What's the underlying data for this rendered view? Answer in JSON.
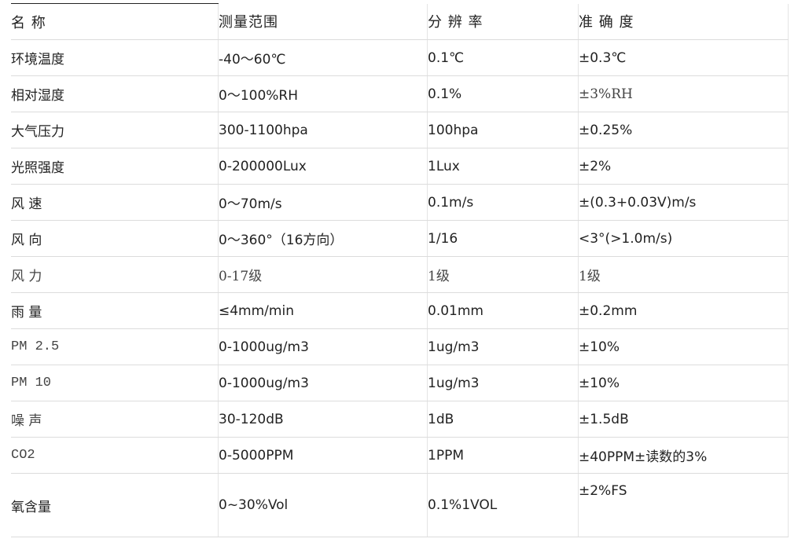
{
  "table": {
    "headers": [
      "名 称",
      "测量范围",
      "分 辨 率",
      "准 确 度"
    ],
    "rows": [
      {
        "name": "环境温度",
        "range": "-40～60℃",
        "resolution": "0.1℃",
        "accuracy": "±0.3℃"
      },
      {
        "name": "相对湿度",
        "range": "0～100%RH",
        "resolution": "0.1%",
        "accuracy": "±3%RH"
      },
      {
        "name": "大气压力",
        "range": "300-1100hpa",
        "resolution": "100hpa",
        "accuracy": "±0.25%"
      },
      {
        "name": "光照强度",
        "range": "0-200000Lux",
        "resolution": "1Lux",
        "accuracy": "±2%"
      },
      {
        "name": "风   速",
        "range": "0～70m/s",
        "resolution": "0.1m/s",
        "accuracy": "±(0.3+0.03V)m/s"
      },
      {
        "name": "风   向",
        "range": "0～360°（16方向）",
        "resolution": "1/16",
        "accuracy": "<3°(>1.0m/s)"
      },
      {
        "name": "风     力",
        "range": "0-17级",
        "resolution": "1级",
        "accuracy": "1级"
      },
      {
        "name": "雨 量",
        "range": "≤4mm/min",
        "resolution": "0.01mm",
        "accuracy": "±0.2mm"
      },
      {
        "name": "PM    2.5",
        "range": "0-1000ug/m3",
        "resolution": "1ug/m3",
        "accuracy": "±10%"
      },
      {
        "name": "PM   10",
        "range": "0-1000ug/m3",
        "resolution": "1ug/m3",
        "accuracy": "±10%"
      },
      {
        "name": "噪      声",
        "range": "30-120dB",
        "resolution": "1dB",
        "accuracy": "±1.5dB"
      },
      {
        "name": "CO2",
        "range": "0-5000PPM",
        "resolution": "1PPM",
        "accuracy": "±40PPM±读数的3%"
      },
      {
        "name": "氧含量",
        "range": "0~30%Vol",
        "resolution": "0.1%1VOL",
        "accuracy": "±2%FS"
      }
    ]
  }
}
